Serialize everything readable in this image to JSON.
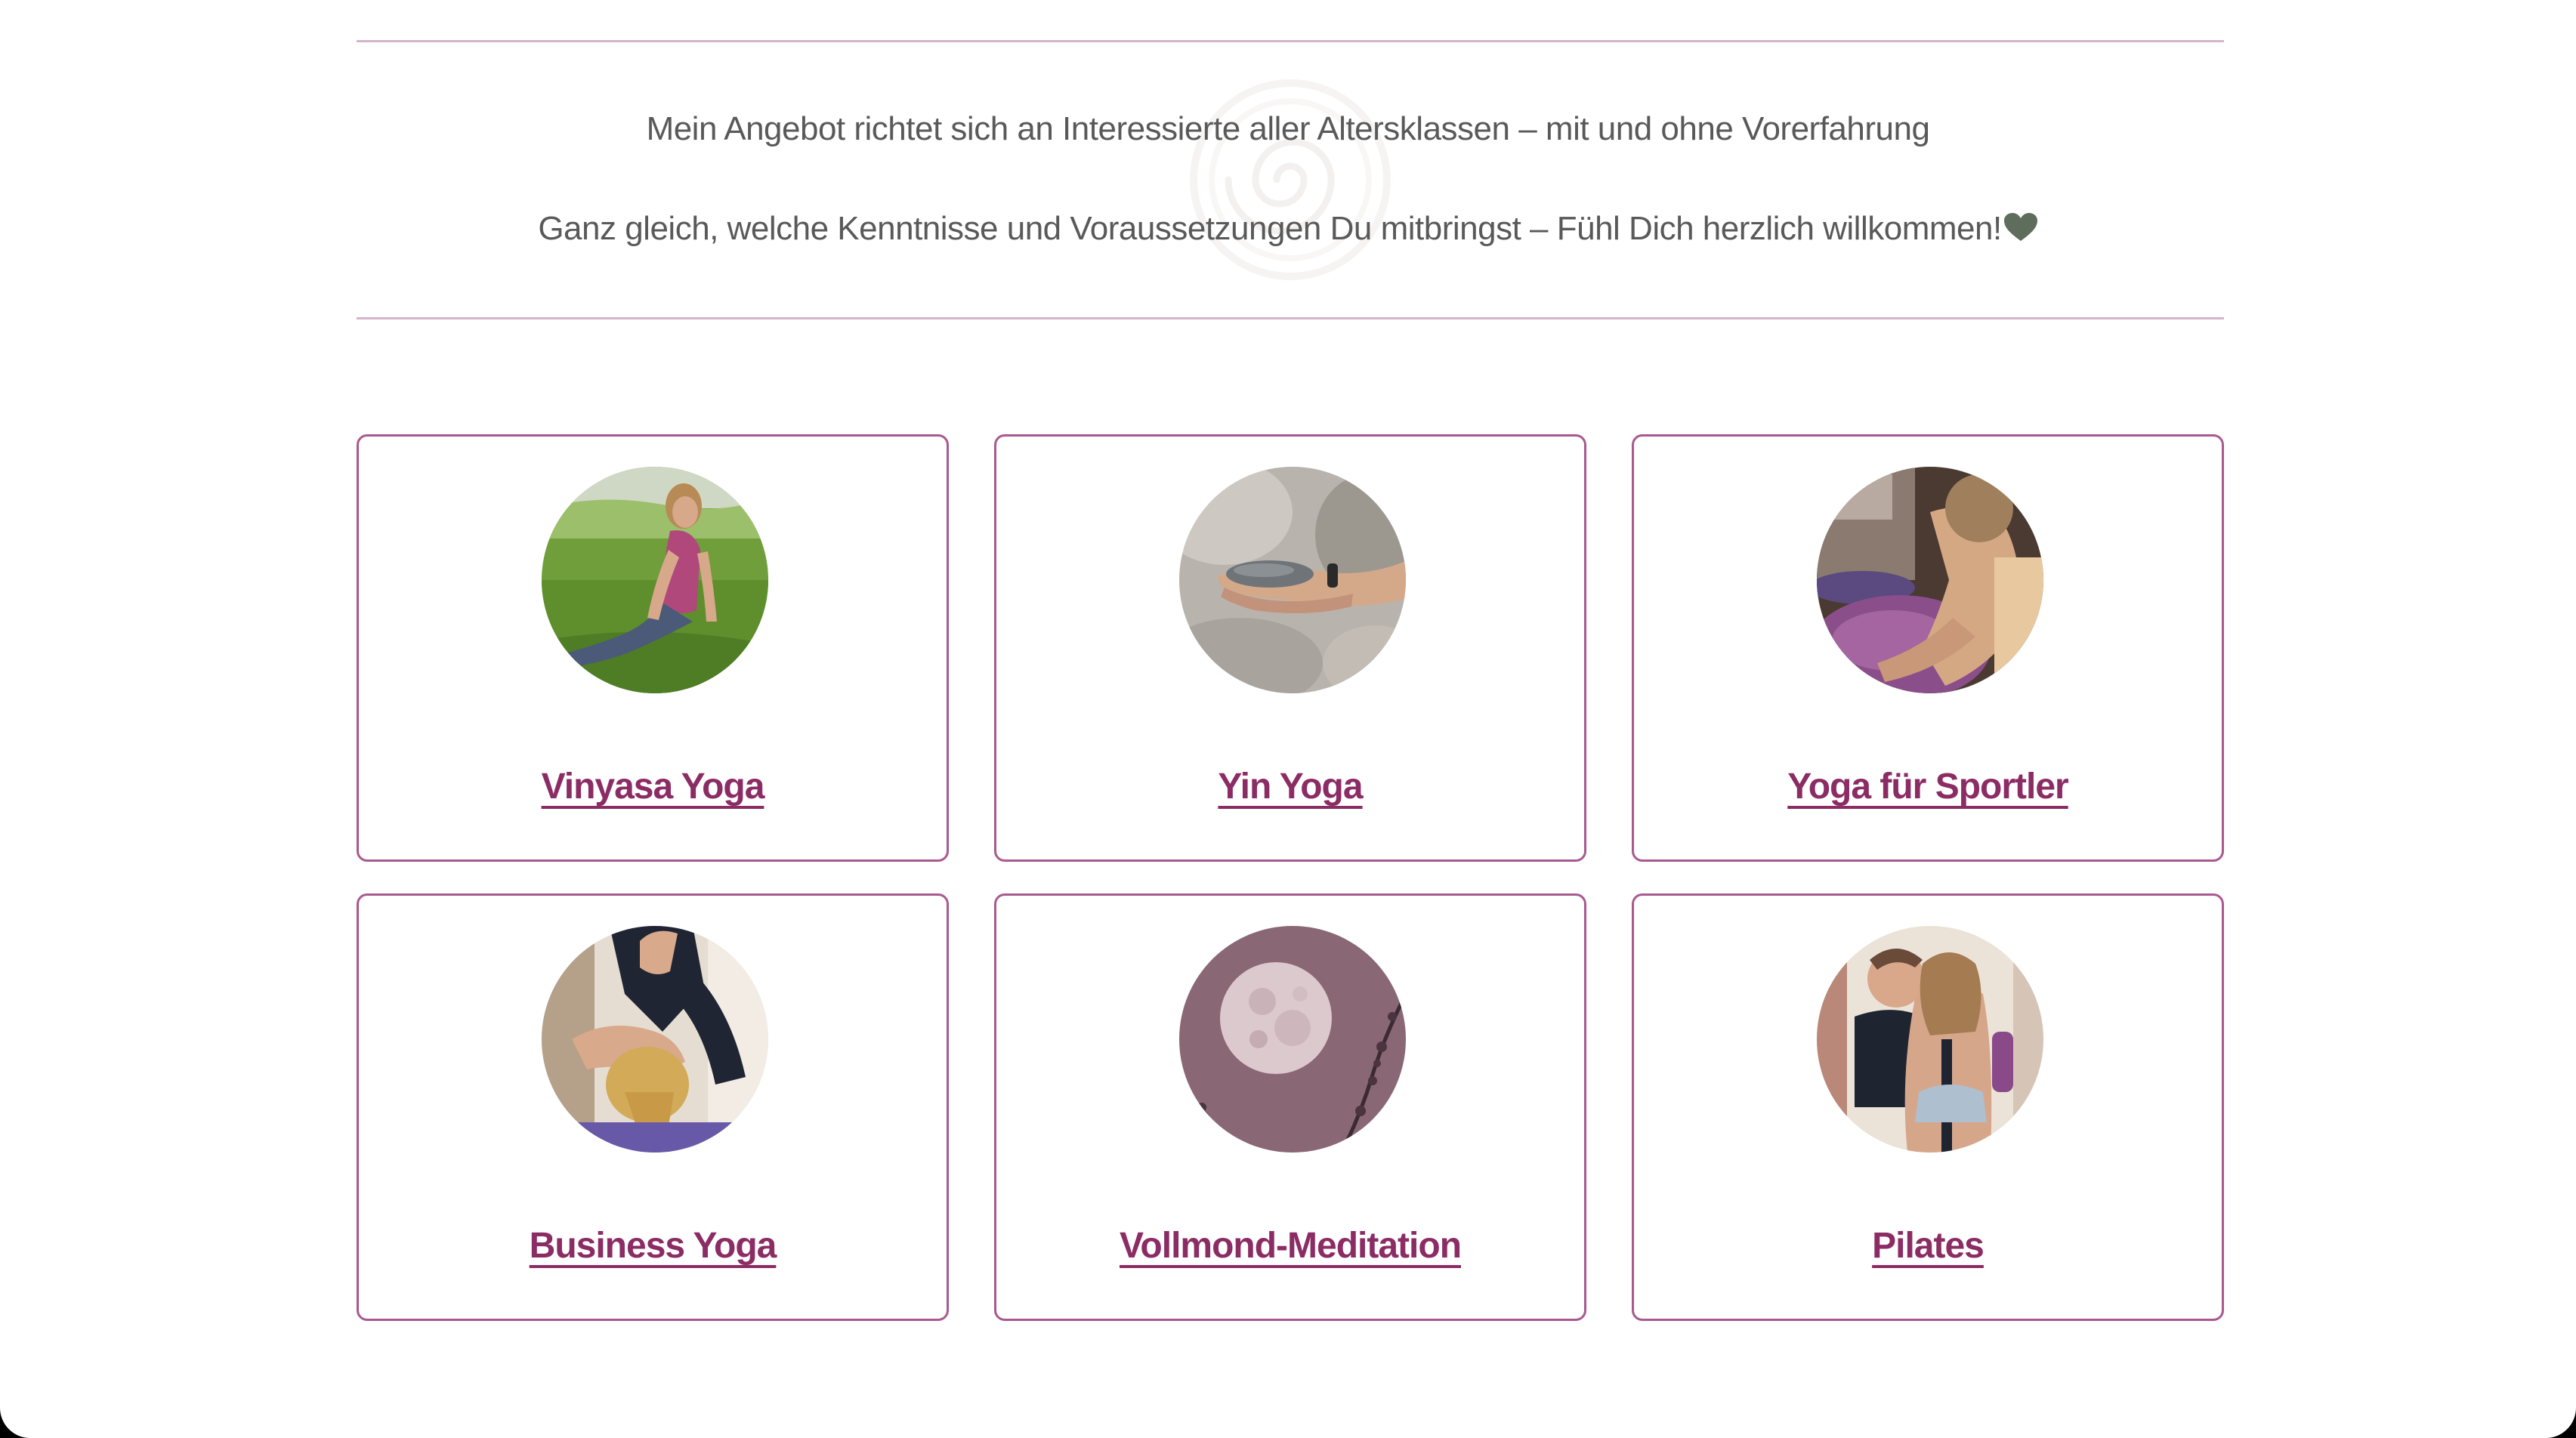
{
  "intro": {
    "line1": "Mein Angebot richtet sich an Interessierte aller Altersklassen – mit und ohne Vorerfahrung",
    "line2": "Ganz gleich, welche Kenntnisse und Voraussetzungen Du mitbringst – Fühl Dich herzlich willkommen!",
    "heart_icon": "heart-icon",
    "heart_color": "#5f6e5c",
    "watermark_icon": "spiral-logo-icon"
  },
  "offers": [
    {
      "title": "Vinyasa Yoga",
      "image": "woman-cobra-pose-on-grass"
    },
    {
      "title": "Yin Yoga",
      "image": "hands-holding-stone"
    },
    {
      "title": "Yoga für Sportler",
      "image": "assisted-stretch-on-mat"
    },
    {
      "title": "Business Yoga",
      "image": "partner-yoga-adjustment"
    },
    {
      "title": "Vollmond-Meditation",
      "image": "full-moon-with-branches"
    },
    {
      "title": "Pilates",
      "image": "women-smiling-in-studio"
    }
  ],
  "colors": {
    "accent": "#8b2c64",
    "card_border": "#a9598f",
    "divider": "#d3b4cb",
    "text": "#595959"
  }
}
